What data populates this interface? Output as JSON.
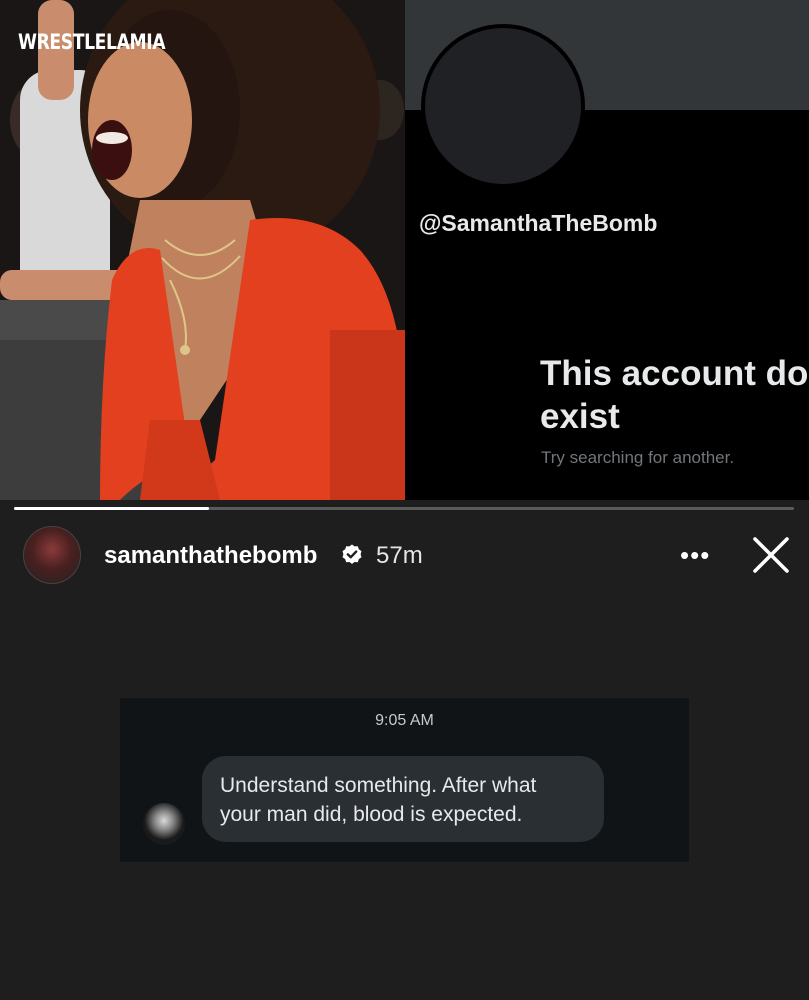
{
  "watermark": "WRESTLELAMIA",
  "profile": {
    "handle": "@SamanthaTheBomb",
    "not_exist_line1": "This account do",
    "not_exist_line2": "exist",
    "try_text": "Try searching for another."
  },
  "story": {
    "progress": 0.25,
    "username": "samanthathebomb",
    "verified_icon": "verified-badge-icon",
    "time_ago": "57m",
    "more_icon": "more-horizontal-icon",
    "more_label": "•••",
    "close_icon": "close-icon"
  },
  "dm": {
    "timestamp": "9:05 AM",
    "message_line1": "Understand something. After what",
    "message_line2": "your man did, blood is expected."
  },
  "colors": {
    "background": "#1e1e1e",
    "profile_bg": "#000000",
    "dm_card": "#101417",
    "bubble": "#2a2f33",
    "dress_red": "#e2401f"
  }
}
